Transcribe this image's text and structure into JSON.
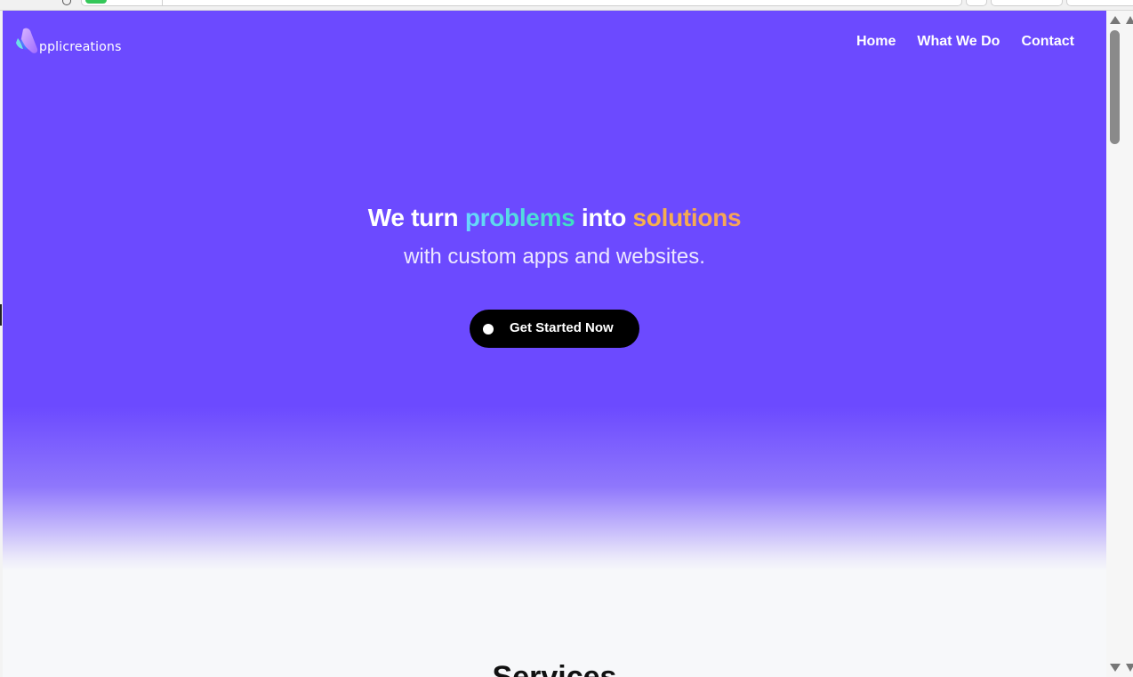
{
  "brand": {
    "wordmark": "pplicreations"
  },
  "nav": {
    "items": [
      {
        "label": "Home"
      },
      {
        "label": "What We Do"
      },
      {
        "label": "Contact"
      }
    ]
  },
  "hero": {
    "line1": {
      "part1": "We turn ",
      "highlight1": "problems",
      "part2": " into ",
      "highlight2": "solutions"
    },
    "line2": "with custom apps and websites.",
    "cta_label": "Get Started Now"
  },
  "section": {
    "heading": "Services"
  },
  "colors": {
    "hero_background": "#6c4aff",
    "problems_gradient": [
      "#6ad7ff",
      "#3de0c1"
    ],
    "solutions_gradient": [
      "#f7b24a",
      "#f6a35a"
    ],
    "cta_background": "#000000",
    "page_background": "#f7f8fa"
  },
  "icons": {
    "logo": "brand-logo-icon",
    "cta": "dot-icon"
  }
}
